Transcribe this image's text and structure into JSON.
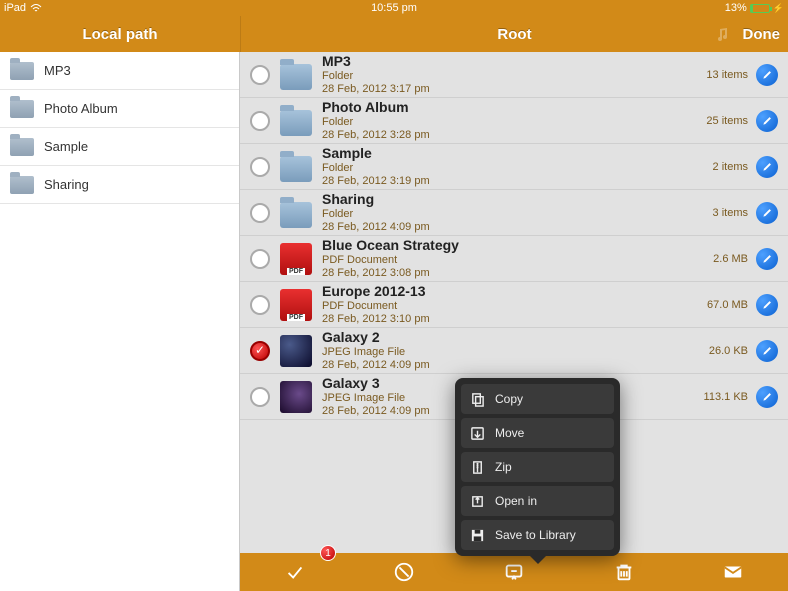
{
  "statusbar": {
    "device": "iPad",
    "time": "10:55 pm",
    "battery": "13%"
  },
  "header": {
    "sidebar_title": "Local path",
    "main_title": "Root",
    "done": "Done"
  },
  "sidebar": {
    "items": [
      {
        "label": "MP3"
      },
      {
        "label": "Photo Album"
      },
      {
        "label": "Sample"
      },
      {
        "label": "Sharing"
      }
    ]
  },
  "files": [
    {
      "name": "MP3",
      "type": "Folder",
      "date": "28 Feb, 2012 3:17 pm",
      "meta": "13 items",
      "icon": "folder",
      "selected": false
    },
    {
      "name": "Photo Album",
      "type": "Folder",
      "date": "28 Feb, 2012 3:28 pm",
      "meta": "25 items",
      "icon": "folder",
      "selected": false
    },
    {
      "name": "Sample",
      "type": "Folder",
      "date": "28 Feb, 2012 3:19 pm",
      "meta": "2 items",
      "icon": "folder",
      "selected": false
    },
    {
      "name": "Sharing",
      "type": "Folder",
      "date": "28 Feb, 2012 4:09 pm",
      "meta": "3 items",
      "icon": "folder",
      "selected": false
    },
    {
      "name": "Blue Ocean Strategy",
      "type": "PDF Document",
      "date": "28 Feb, 2012 3:08 pm",
      "meta": "2.6 MB",
      "icon": "pdf",
      "selected": false
    },
    {
      "name": "Europe 2012-13",
      "type": "PDF Document",
      "date": "28 Feb, 2012 3:10 pm",
      "meta": "67.0 MB",
      "icon": "pdf",
      "selected": false
    },
    {
      "name": "Galaxy 2",
      "type": "JPEG Image File",
      "date": "28 Feb, 2012 4:09 pm",
      "meta": "26.0 KB",
      "icon": "img1",
      "selected": true
    },
    {
      "name": "Galaxy 3",
      "type": "JPEG Image File",
      "date": "28 Feb, 2012 4:09 pm",
      "meta": "113.1 KB",
      "icon": "img2",
      "selected": false
    }
  ],
  "popover": {
    "items": [
      {
        "label": "Copy",
        "icon": "copy"
      },
      {
        "label": "Move",
        "icon": "move"
      },
      {
        "label": "Zip",
        "icon": "zip"
      },
      {
        "label": "Open in",
        "icon": "openin"
      },
      {
        "label": "Save to Library",
        "icon": "save"
      }
    ]
  },
  "bottombar": {
    "badge": "1"
  }
}
